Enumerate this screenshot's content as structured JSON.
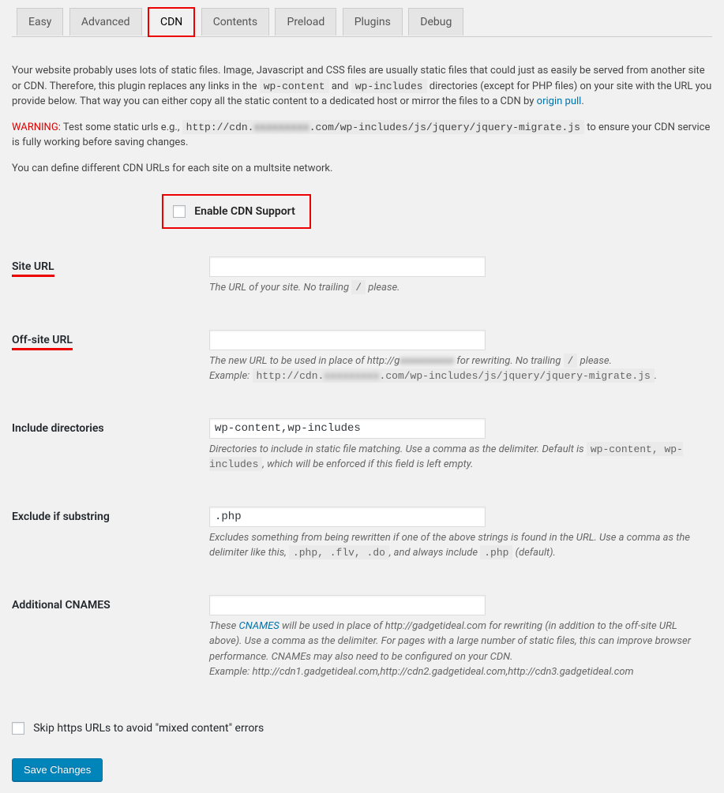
{
  "tabs": {
    "t0": "Easy",
    "t1": "Advanced",
    "t2": "CDN",
    "t3": "Contents",
    "t4": "Preload",
    "t5": "Plugins",
    "t6": "Debug"
  },
  "intro": {
    "line1a": "Your website probably uses lots of static files. Image, Javascript and CSS files are usually static files that could just as easily be served from another site or CDN. Therefore, this plugin replaces any links in the ",
    "code1": "wp-content",
    "line1b": " and ",
    "code2": "wp-includes",
    "line1c": " directories (except for PHP files) on your site with the URL you provide below. That way you can either copy all the static content to a dedicated host or mirror the files to a CDN by ",
    "link1": "origin pull",
    "line1d": "."
  },
  "warning": {
    "label": "WARNING:",
    "text1": " Test some static urls e.g., ",
    "code1a": "http://cdn.",
    "code1blur": "xxxxxxxxx",
    "code1b": ".com/wp-includes/js/jquery/jquery-migrate.js",
    "text2": " to ensure your CDN service is fully working before saving changes."
  },
  "multisite_note": "You can define different CDN URLs for each site on a multsite network.",
  "enable": {
    "label": "Enable CDN Support"
  },
  "fields": {
    "site_url": {
      "label": "Site URL",
      "value": "",
      "desc1": "The URL of your site. No trailing ",
      "desc_code": "/",
      "desc2": " please."
    },
    "offsite_url": {
      "label": "Off-site URL",
      "value": "",
      "desc1": "The new URL to be used in place of http://g",
      "desc_blur": "xxxxxxxxxxx",
      "desc2": " for rewriting. No trailing ",
      "desc_code": "/",
      "desc3": " please.",
      "example_label": "Example: ",
      "example_code_a": "http://cdn.",
      "example_code_blur": "xxxxxxxxx",
      "example_code_b": ".com/wp-includes/js/jquery/jquery-migrate.js",
      "example_trail": "."
    },
    "include_dirs": {
      "label": "Include directories",
      "value": "wp-content,wp-includes",
      "desc1": "Directories to include in static file matching. Use a comma as the delimiter. Default is ",
      "desc_code": "wp-content, wp-includes",
      "desc2": ", which will be enforced if this field is left empty."
    },
    "exclude_substring": {
      "label": "Exclude if substring",
      "value": ".php",
      "desc1": "Excludes something from being rewritten if one of the above strings is found in the URL. Use a comma as the delimiter like this, ",
      "desc_code1": ".php, .flv, .do",
      "desc_mid": ", and always include ",
      "desc_code2": ".php",
      "desc_end": " (default)."
    },
    "cnames": {
      "label": "Additional CNAMES",
      "value": "",
      "desc1a": "These ",
      "desc_link": "CNAMES",
      "desc1b": " will be used in place of http://gadgetideal.com for rewriting (in addition to the off-site URL above). Use a comma as the delimiter. For pages with a large number of static files, this can improve browser performance. CNAMEs may also need to be configured on your CDN.",
      "example": "Example: http://cdn1.gadgetideal.com,http://cdn2.gadgetideal.com,http://cdn3.gadgetideal.com"
    }
  },
  "skip_https": {
    "label": "Skip https URLs to avoid \"mixed content\" errors"
  },
  "save_button": "Save Changes"
}
